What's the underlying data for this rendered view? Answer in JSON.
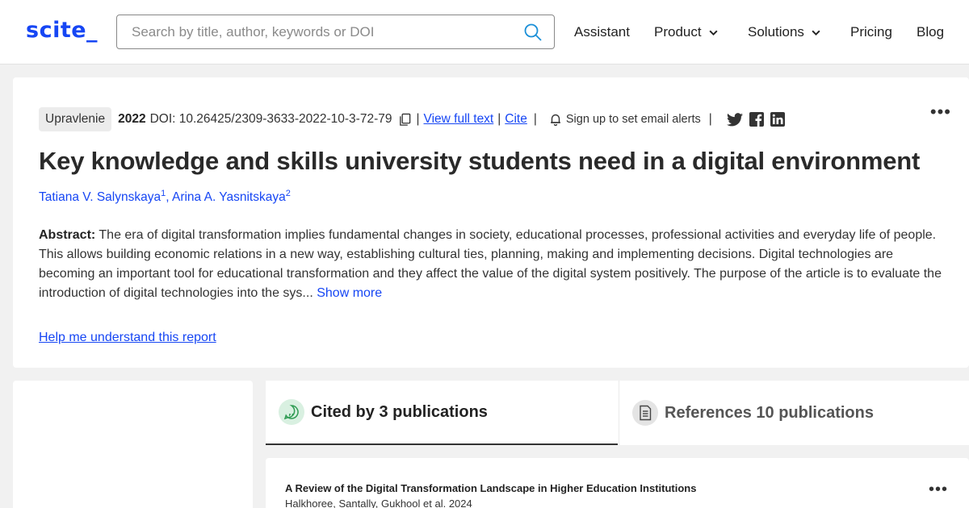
{
  "header": {
    "logo": "scite_",
    "search_placeholder": "Search by title, author, keywords or DOI",
    "nav": [
      "Assistant",
      "Product",
      "Solutions",
      "Pricing",
      "Blog"
    ]
  },
  "article": {
    "journal": "Upravlenie",
    "year": "2022",
    "doi": "DOI: 10.26425/2309-3633-2022-10-3-72-79",
    "view_full_text": "View full text",
    "cite": "Cite",
    "alerts": "Sign up to set email alerts",
    "title": "Key knowledge and skills university students need in a digital environment",
    "authors": [
      {
        "name": "Tatiana V. Salynskaya",
        "sup": "1"
      },
      {
        "name": "Arina A. Yasnitskaya",
        "sup": "2"
      }
    ],
    "abstract_label": "Abstract:",
    "abstract_text": "The era of digital transformation implies fundamental changes in society, educational processes, professional activities and everyday life of people. This allows building economic relations in a new way, establishing cultural ties, planning, making and implementing decisions. Digital technologies are becoming an important tool for educational transformation and they affect the value of the digital system positively. The purpose of the article is to evaluate the introduction of digital technologies into the sys...",
    "show_more": "Show more",
    "help_link": "Help me understand this report",
    "more_menu": "•••"
  },
  "tabs": {
    "cited": "Cited by 3 publications",
    "references": "References 10 publications"
  },
  "results": [
    {
      "title": "A Review of the Digital Transformation Landscape in Higher Education Institutions",
      "authors": "Halkhoree, Santally, Gukhool et al. 2024",
      "more_menu": "•••"
    }
  ],
  "colors": {
    "brand": "#1646f4",
    "background": "#f1f1f1",
    "text": "#222222"
  },
  "icons": [
    "search-icon",
    "copy-icon",
    "bell-icon",
    "twitter-icon",
    "facebook-icon",
    "linkedin-icon",
    "chevron-down-icon",
    "quote-bubble-icon",
    "document-icon",
    "more-icon"
  ]
}
